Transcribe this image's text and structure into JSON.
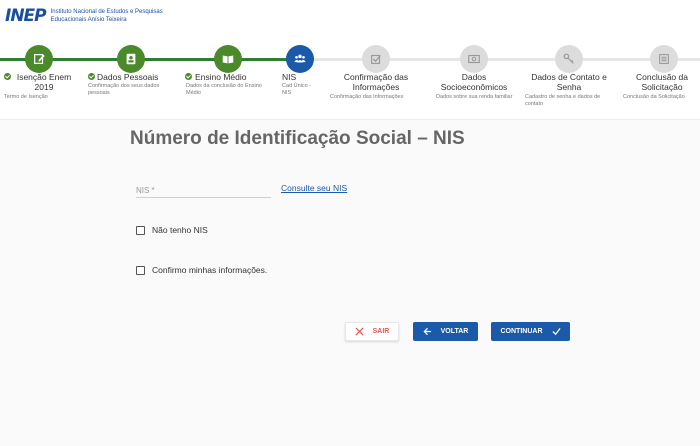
{
  "header": {
    "logo_mark": "INEP",
    "org_line1": "Instituto Nacional de Estudos e Pesquisas",
    "org_line2": "Educacionais Anísio Teixeira"
  },
  "steps": [
    {
      "title": "Isenção Enem 2019",
      "subtitle": "Termo de Isenção",
      "state": "done",
      "icon": "pencil-icon"
    },
    {
      "title": "Dados Pessoais",
      "subtitle": "Confirmação dos seus dados pessoais",
      "state": "done",
      "icon": "id-card-icon"
    },
    {
      "title": "Ensino Médio",
      "subtitle": "Dados da conclusão do Ensino Médio",
      "state": "done",
      "icon": "book-icon"
    },
    {
      "title": "NIS",
      "subtitle": "Cad Único - NIS",
      "state": "current",
      "icon": "people-icon"
    },
    {
      "title": "Confirmação das Informações",
      "subtitle": "Confirmação das Informações",
      "state": "todo",
      "icon": "checkbox-icon"
    },
    {
      "title": "Dados Socioeconômicos",
      "subtitle": "Dados sobre sua renda familiar",
      "state": "todo",
      "icon": "money-icon"
    },
    {
      "title": "Dados de Contato e Senha",
      "subtitle": "Cadastro de senha e dados de contato",
      "state": "todo",
      "icon": "key-icon"
    },
    {
      "title": "Conclusão da Solicitação",
      "subtitle": "Conclusão da Solicitação",
      "state": "todo",
      "icon": "list-icon"
    }
  ],
  "main": {
    "title": "Número de Identificação Social – NIS",
    "nis_label": "NIS *",
    "consult_link": "Consulte seu NIS",
    "checkbox_no_nis": "Não tenho NIS",
    "checkbox_confirm": "Confirmo minhas informações."
  },
  "actions": {
    "exit_label": "SAIR",
    "back_label": "VOLTAR",
    "continue_label": "CONTINUAR"
  },
  "colors": {
    "primary": "#1a5aa8",
    "done": "#4a8a2a",
    "danger": "#e05a4f"
  }
}
